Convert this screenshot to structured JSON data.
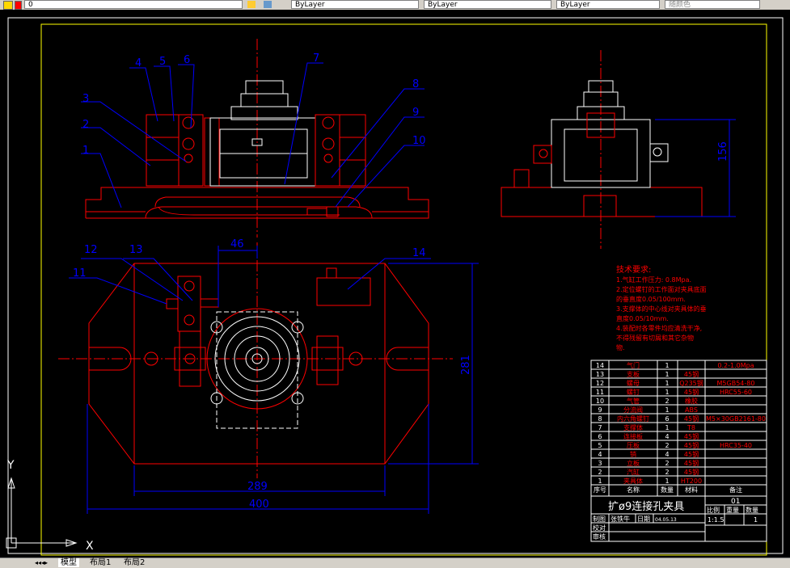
{
  "toolbar": {
    "layer_value": "0",
    "color_value": "ByLayer",
    "linetype_value": "ByLayer",
    "lineweight_value": "ByLayer",
    "plotstyle_value": "随颜色"
  },
  "drawing": {
    "part_labels": [
      "1",
      "2",
      "3",
      "4",
      "5",
      "6",
      "7",
      "8",
      "9",
      "10",
      "11",
      "12",
      "13",
      "14"
    ],
    "dimensions": {
      "d46": "46",
      "d156": "156",
      "d281": "281",
      "d289": "289",
      "d400": "400"
    },
    "tech_requirements": {
      "title": "技术要求:",
      "lines": [
        "1.气缸工作压力: 0.8Mpa.",
        "2.定位螺钉的工作面对夹具底面",
        "的垂直度0.05/100mm.",
        "3.支撑体的中心线对夹具体的垂",
        "直度0.05/10mm.",
        "4.装配时各零件均应清洗干净,",
        "不得残留有切屑和其它杂物",
        "物."
      ]
    },
    "bom": {
      "rows": [
        {
          "no": "14",
          "name": "气门",
          "qty": "1",
          "material": "",
          "note": "0.2-1.0Mpa"
        },
        {
          "no": "13",
          "name": "支板",
          "qty": "1",
          "material": "45钢",
          "note": ""
        },
        {
          "no": "12",
          "name": "螺母",
          "qty": "1",
          "material": "Q235钢",
          "note": "M5GB54-80"
        },
        {
          "no": "11",
          "name": "螺钉",
          "qty": "1",
          "material": "45钢",
          "note": "HRC55-60"
        },
        {
          "no": "10",
          "name": "气管",
          "qty": "2",
          "material": "橡胶",
          "note": ""
        },
        {
          "no": "9",
          "name": "分流阀",
          "qty": "1",
          "material": "ABS",
          "note": ""
        },
        {
          "no": "8",
          "name": "内六角螺钉",
          "qty": "6",
          "material": "45钢",
          "note": "M5×30GB2161-80"
        },
        {
          "no": "7",
          "name": "支撑体",
          "qty": "1",
          "material": "T8",
          "note": ""
        },
        {
          "no": "6",
          "name": "连接板",
          "qty": "4",
          "material": "45钢",
          "note": ""
        },
        {
          "no": "5",
          "name": "压板",
          "qty": "2",
          "material": "45钢",
          "note": "HRC35-40"
        },
        {
          "no": "4",
          "name": "销",
          "qty": "4",
          "material": "45钢",
          "note": ""
        },
        {
          "no": "3",
          "name": "立板",
          "qty": "2",
          "material": "45钢",
          "note": ""
        },
        {
          "no": "2",
          "name": "汽缸",
          "qty": "2",
          "material": "45钢",
          "note": ""
        },
        {
          "no": "1",
          "name": "夹具体",
          "qty": "1",
          "material": "HT200",
          "note": ""
        }
      ],
      "header": {
        "no": "序号",
        "name": "名称",
        "qty": "数量",
        "material": "材料",
        "note": "备注"
      }
    },
    "title_block": {
      "title": "扩ø9连接孔夹具",
      "drawing_no": "01",
      "labels": {
        "scale": "比例",
        "weight": "重量",
        "count": "数量"
      },
      "scale_value": "1:1.5",
      "count_value": "1",
      "drawn_label": "制图",
      "drawn_by": "张铁牛",
      "date_label": "日期",
      "date_value": "04.05.13",
      "check_label": "校对",
      "review_label": "审核"
    },
    "ucs": {
      "x": "X",
      "y": "Y"
    }
  },
  "statusbar": {
    "tabs": [
      "模型",
      "布局1",
      "布局2"
    ]
  },
  "colors": {
    "line": "#ff0000",
    "leader": "#0000ff",
    "text": "#ff0000",
    "white": "#ffffff",
    "frame": "#ffff00",
    "dim": "#0000ff"
  }
}
